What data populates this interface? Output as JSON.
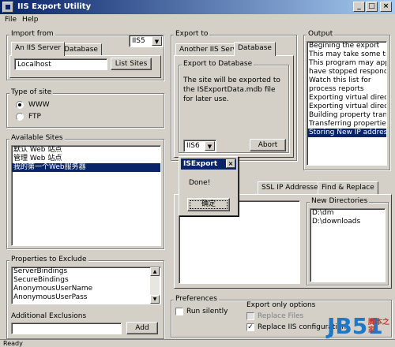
{
  "window": {
    "title": "IIS Export Utility",
    "buttons": [
      "_",
      "□",
      "×"
    ]
  },
  "menu": [
    "File",
    "Help"
  ],
  "import_from": {
    "legend": "Import from",
    "tabs": [
      "An IIS Server",
      "Database"
    ],
    "server_value": "Localhost",
    "list_sites_button": "List Sites",
    "version": "IIS5"
  },
  "type_of_site": {
    "legend": "Type of site",
    "options": [
      "WWW",
      "FTP"
    ],
    "selected": "WWW"
  },
  "available_sites": {
    "legend": "Available Sites",
    "items": [
      "默认 Web 站点",
      "管理 Web 站点",
      "我的第一个Web服务器"
    ],
    "selected_index": 2
  },
  "properties_to_exclude": {
    "legend": "Properties to Exclude",
    "items": [
      "ServerBindings",
      "SecureBindings",
      "AnonymousUserName",
      "AnonymousUserPass"
    ]
  },
  "additional_exclusions": {
    "label": "Additional Exclusions",
    "add_button": "Add"
  },
  "export_to": {
    "legend": "Export to",
    "tabs": [
      "Another IIS Server",
      "Database"
    ],
    "group_legend": "Export to Database",
    "description": "The site will be exported to the ISExportData.mdb file for later use.",
    "version": "IIS6",
    "abort_button": "Abort"
  },
  "output": {
    "legend": "Output",
    "lines": [
      "Begining the export",
      "This may take some time",
      "This program may appear a",
      "have stopped responding",
      "Watch this list for",
      "process reports",
      "Exporting virtual directory JRo",
      "Exporting virtual directory JRo",
      "Building property transfer list",
      "Transferring properties....",
      "Storing New IP addresses"
    ],
    "selected_index": 10
  },
  "middle_tabs": [
    "SSL IP Addresses",
    "Find & Replace"
  ],
  "new_directories": {
    "legend": "New Directories",
    "items": [
      "D:\\dm",
      "D:\\downloads"
    ]
  },
  "preferences": {
    "legend": "Preferences",
    "run_silently": "Run silently"
  },
  "export_only": {
    "legend": "Export only options",
    "replace_files": "Replace Files",
    "replace_config": "Replace IIS configuration"
  },
  "status_text": "Ready",
  "dialog": {
    "title": "ISExport",
    "message": "Done!",
    "ok_button": "确定"
  },
  "watermark": {
    "text": "JB51",
    "sub": "脚本之家",
    "color": "#1e78c8"
  }
}
